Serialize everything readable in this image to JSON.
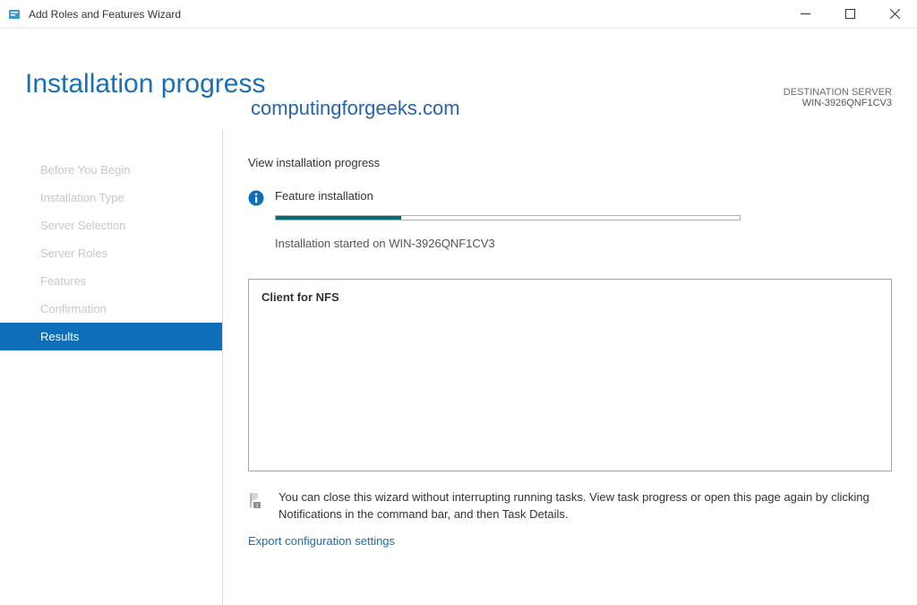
{
  "titlebar": {
    "title": "Add Roles and Features Wizard"
  },
  "header": {
    "page_title": "Installation progress",
    "dest_label": "DESTINATION SERVER",
    "dest_name": "WIN-3926QNF1CV3",
    "watermark": "computingforgeeks.com"
  },
  "sidebar": {
    "items": [
      {
        "label": "Before You Begin"
      },
      {
        "label": "Installation Type"
      },
      {
        "label": "Server Selection"
      },
      {
        "label": "Server Roles"
      },
      {
        "label": "Features"
      },
      {
        "label": "Confirmation"
      },
      {
        "label": "Results"
      }
    ]
  },
  "main": {
    "section_title": "View installation progress",
    "status_title": "Feature installation",
    "status_message": "Installation started on WIN-3926QNF1CV3",
    "results_item": "Client for NFS",
    "info_note": "You can close this wizard without interrupting running tasks. View task progress or open this page again by clicking Notifications in the command bar, and then Task Details.",
    "export_link": "Export configuration settings"
  }
}
